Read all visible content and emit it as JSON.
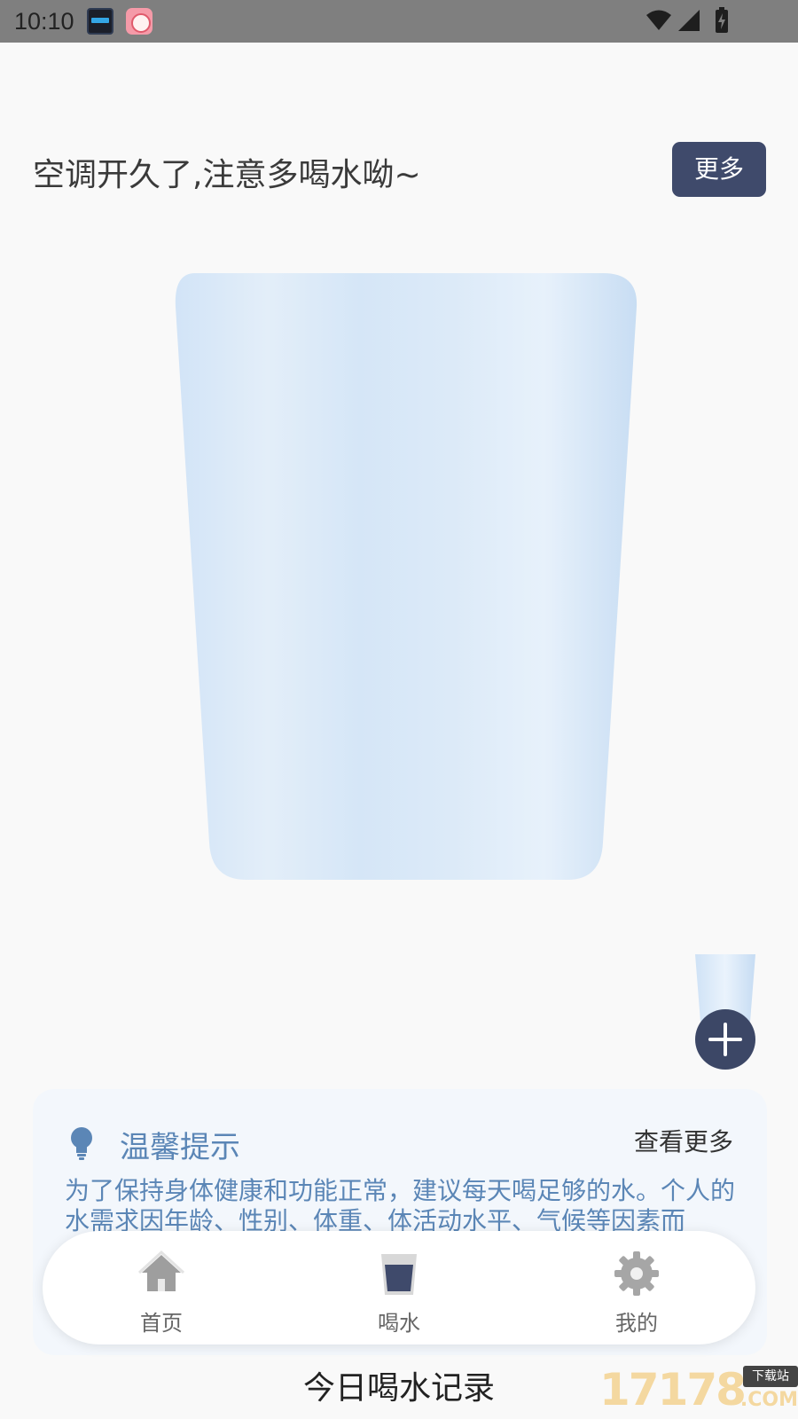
{
  "status_bar": {
    "time": "10:10",
    "notification_icons": [
      "clock-widget-icon",
      "app-notification-icon"
    ],
    "system_icons": [
      "wifi-icon",
      "signal-icon",
      "battery-charging-icon"
    ]
  },
  "header": {
    "message": "空调开久了,注意多喝水呦~",
    "more_label": "更多"
  },
  "cup": {
    "fill_level": 0,
    "colors": {
      "glass": "#d6e7f8",
      "glass_edge": "#c4dbf2",
      "water": "#3f4a6b"
    }
  },
  "add_button": {
    "icon": "plus-icon"
  },
  "tips": {
    "icon": "lightbulb-icon",
    "title": "温馨提示",
    "more_label": "查看更多",
    "body": "为了保持身体健康和功能正常，建议每天喝足够的水。个人的水需求因年龄、性别、体重、体活动水平、气候等因素而"
  },
  "bottom_nav": {
    "items": [
      {
        "label": "首页",
        "icon": "home-icon",
        "active": false
      },
      {
        "label": "喝水",
        "icon": "water-glass-icon",
        "active": true
      },
      {
        "label": "我的",
        "icon": "gear-icon",
        "active": false
      }
    ]
  },
  "record_title": "今日喝水记录",
  "watermark": {
    "number": "17178",
    "badge": "下载站",
    "suffix": ".COM"
  },
  "theme": {
    "accent": "#3f4a6b",
    "tips_text": "#5b86b6",
    "background": "#f9f9f9"
  }
}
